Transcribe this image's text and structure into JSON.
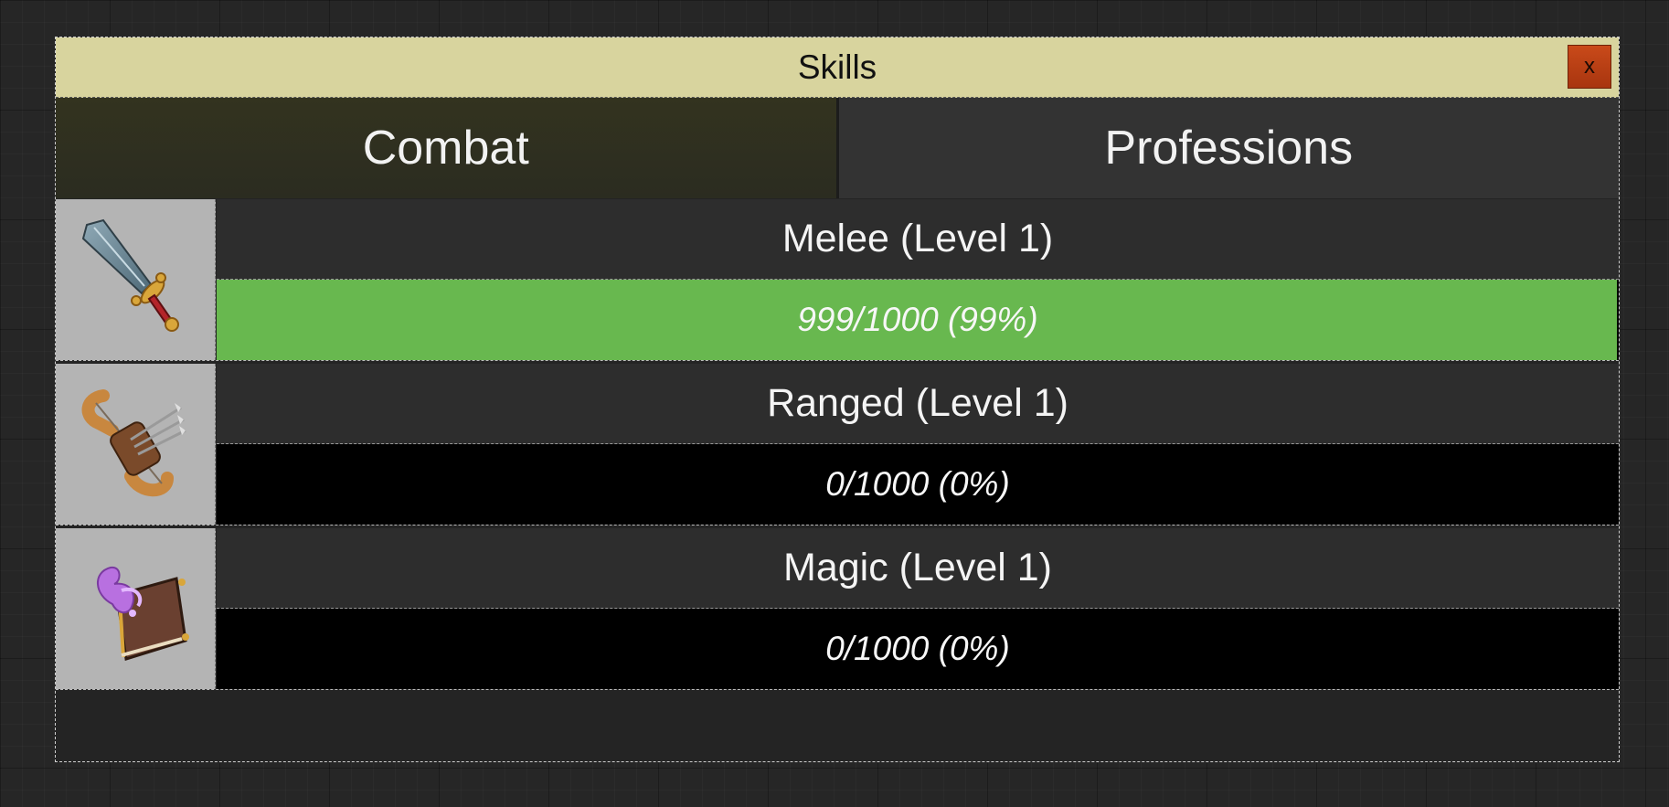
{
  "window": {
    "title": "Skills",
    "close_label": "x"
  },
  "tabs": [
    {
      "label": "Combat",
      "active": true
    },
    {
      "label": "Professions",
      "active": false
    }
  ],
  "skills": [
    {
      "name": "Melee (Level 1)",
      "icon": "sword-icon",
      "progress_text": "999/1000 (99%)",
      "progress": 0.999
    },
    {
      "name": "Ranged (Level 1)",
      "icon": "crossbow-icon",
      "progress_text": "0/1000 (0%)",
      "progress": 0
    },
    {
      "name": "Magic (Level 1)",
      "icon": "spellbook-icon",
      "progress_text": "0/1000 (0%)",
      "progress": 0
    }
  ],
  "colors": {
    "title_bar": "#d8d49e",
    "close_button": "#b83f14",
    "progress_fill": "#68b84f",
    "progress_empty": "#000000"
  }
}
